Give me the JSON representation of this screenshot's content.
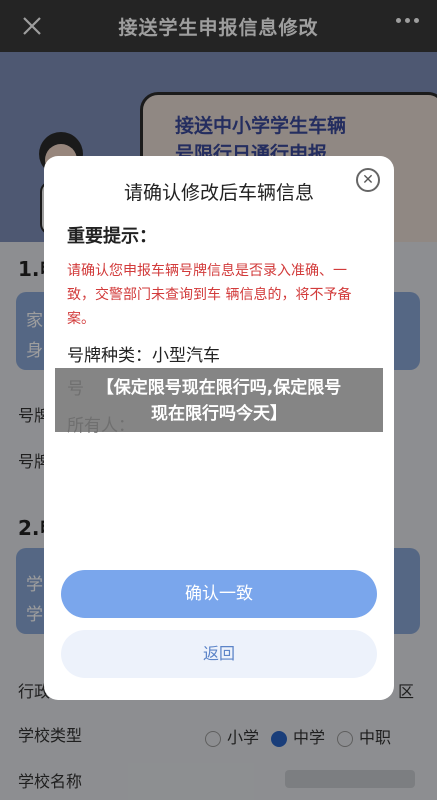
{
  "topbar": {
    "title": "接送学生申报信息修改"
  },
  "banner": {
    "line1": "接送中小学学生车辆",
    "line2": "号限行日通行申报"
  },
  "background": {
    "section1_num": "1.申",
    "box1_line1": "家",
    "box1_line2": "身",
    "row_a": "号牌",
    "row_b": "号牌",
    "section2_num": "2.申",
    "box2_line1": "学",
    "box2_line2": "学",
    "row_district_label": "行政",
    "row_district_value": "区",
    "row_school_type_label": "学校类型",
    "school_types": [
      "小学",
      "中学",
      "中职"
    ],
    "row_school_name_label": "学校名称"
  },
  "modal": {
    "title": "请确认修改后车辆信息",
    "notice_heading": "重要提示：",
    "notice_text": "请确认您申报车辆号牌信息是否录入准确、一致，交警部门未查询到车 辆信息的，将不予备案。",
    "plate_type_label": "号牌种类：",
    "plate_type_value": "小型汽车",
    "plate_number_label": "号",
    "owner_label": "所有人：",
    "confirm_label": "确认一致",
    "back_label": "返回"
  },
  "overlay": {
    "line1": "【保定限号现在限行吗,保定限号",
    "line2": "现在限行吗今天】"
  },
  "colors": {
    "topbar": "#3a3a3a",
    "primary": "#7aa6ec",
    "warning": "#d23b3b"
  }
}
